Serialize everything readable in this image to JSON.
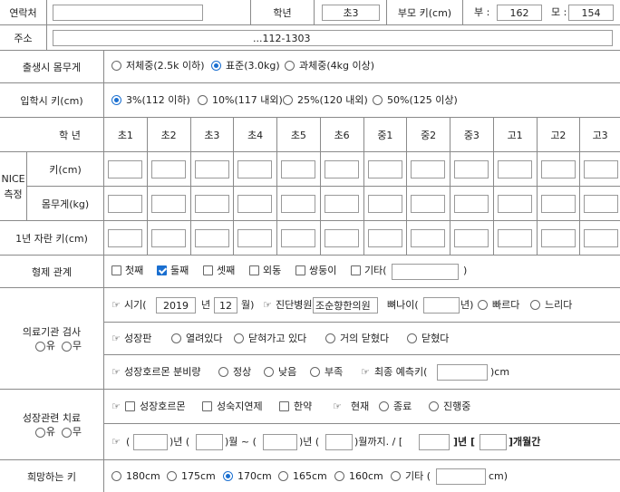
{
  "contact": {
    "label": "연락처",
    "value": ""
  },
  "grade": {
    "label": "학년",
    "value": "초3"
  },
  "parent_height": {
    "label": "부모 키(cm)",
    "father_label": "부 :",
    "father_value": "162",
    "mother_label": "모 :",
    "mother_value": "154"
  },
  "address": {
    "label": "주소",
    "value": "...112-1303"
  },
  "birth_weight": {
    "label": "출생시 몸무게",
    "options": [
      "저체중(2.5k 이하)",
      "표준(3.0kg)",
      "과체중(4kg 이상)"
    ],
    "selected": 1
  },
  "entry_height": {
    "label": "입학시 키(cm)",
    "options": [
      "3%(112 이하)",
      "10%(117 내외)",
      "25%(120 내외)",
      "50%(125 이상)"
    ],
    "selected": 0
  },
  "nice": {
    "group_label": "NICE 측정",
    "grade_row_label": "학 년",
    "grades": [
      "초1",
      "초2",
      "초3",
      "초4",
      "초5",
      "초6",
      "중1",
      "중2",
      "중3",
      "고1",
      "고2",
      "고3"
    ],
    "height_label": "키(cm)",
    "weight_label": "몸무게(kg)"
  },
  "growth_per_year": {
    "label": "1년 자란 키(cm)"
  },
  "siblings": {
    "label": "형제 관계",
    "options": [
      "첫째",
      "둘째",
      "셋째",
      "외동",
      "쌍둥이",
      "기타("
    ],
    "closing": ")",
    "checked": [
      1
    ]
  },
  "medical": {
    "label": "의료기관 검사",
    "yes": "유",
    "no": "무",
    "row1": {
      "time_prefix": "시기(",
      "year": "2019",
      "year_unit": "년",
      "month": "12",
      "month_unit": "월)",
      "hospital_prefix": "진단병원(",
      "hospital": "조순향한의원",
      "bone_prefix": "뼈나이(",
      "bone_suffix": "년)",
      "fast": "빠르다",
      "slow": "느리다"
    },
    "row2": {
      "label": "성장판",
      "options": [
        "열려있다",
        "닫혀가고 있다",
        "거의 닫혔다",
        "닫혔다"
      ]
    },
    "row3": {
      "label": "성장호르몬 분비량",
      "options": [
        "정상",
        "낮음",
        "부족"
      ],
      "predict_prefix": "최종 예측키(",
      "predict_suffix": ")cm"
    }
  },
  "treatment": {
    "label": "성장관련 치료",
    "yes": "유",
    "no": "무",
    "row1": {
      "options": [
        "성장호르몬",
        "성숙지연제",
        "한약"
      ],
      "status_options": [
        "현재",
        "종료",
        "진행중"
      ]
    },
    "row2": {
      "p1": "(",
      "p2": ")년 (",
      "p3": ")월 ~ (",
      "p4": ")년 (",
      "p5": ")월까지. / [",
      "p6": "]년 [",
      "p7": "]개월간"
    }
  },
  "desired_height": {
    "label": "희망하는 키",
    "options": [
      "180cm",
      "175cm",
      "170cm",
      "165cm",
      "160cm",
      "기타 ("
    ],
    "closing": "cm)",
    "selected": 2
  }
}
